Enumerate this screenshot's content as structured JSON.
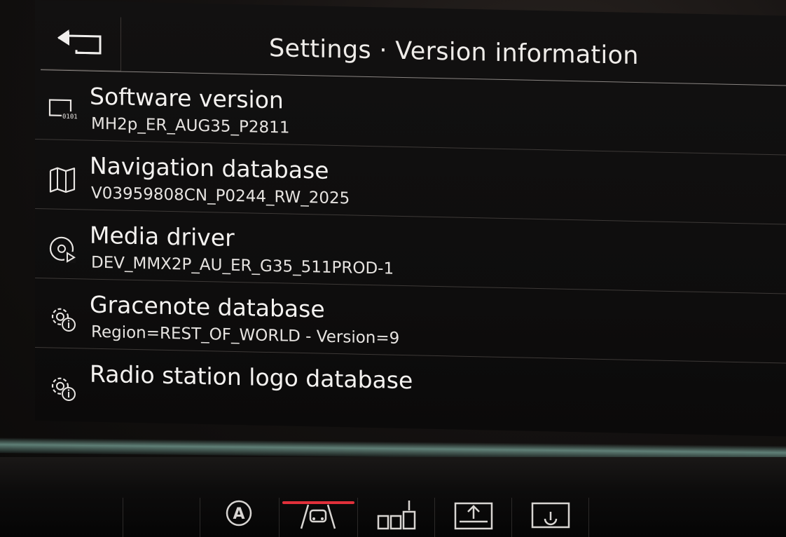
{
  "header": {
    "title": "Settings · Version information",
    "back_icon": "back-arrow-icon"
  },
  "items": [
    {
      "label": "Software version",
      "value": "MH2p_ER_AUG35_P2811",
      "icon": "software-chip-icon"
    },
    {
      "label": "Navigation database",
      "value": "V03959808CN_P0244_RW_2025",
      "icon": "map-icon"
    },
    {
      "label": "Media driver",
      "value": "DEV_MMX2P_AU_ER_G35_511PROD-1",
      "icon": "media-disc-icon"
    },
    {
      "label": "Gracenote database",
      "value": "Region=REST_OF_WORLD - Version=9",
      "icon": "gear-info-icon"
    },
    {
      "label": "Radio station logo database",
      "value": "",
      "icon": "gear-info-icon"
    }
  ],
  "hardware_buttons": [
    {
      "icon": "auto-start-stop-icon",
      "text": "A"
    },
    {
      "icon": "driver-assist-icon",
      "active": true
    },
    {
      "icon": "parking-icon"
    },
    {
      "icon": "hazard-settings-icon"
    },
    {
      "icon": "screen-off-icon"
    }
  ],
  "colors": {
    "accent_red": "#e0303a",
    "text": "#f4f2f0",
    "divider": "#3d3937"
  }
}
